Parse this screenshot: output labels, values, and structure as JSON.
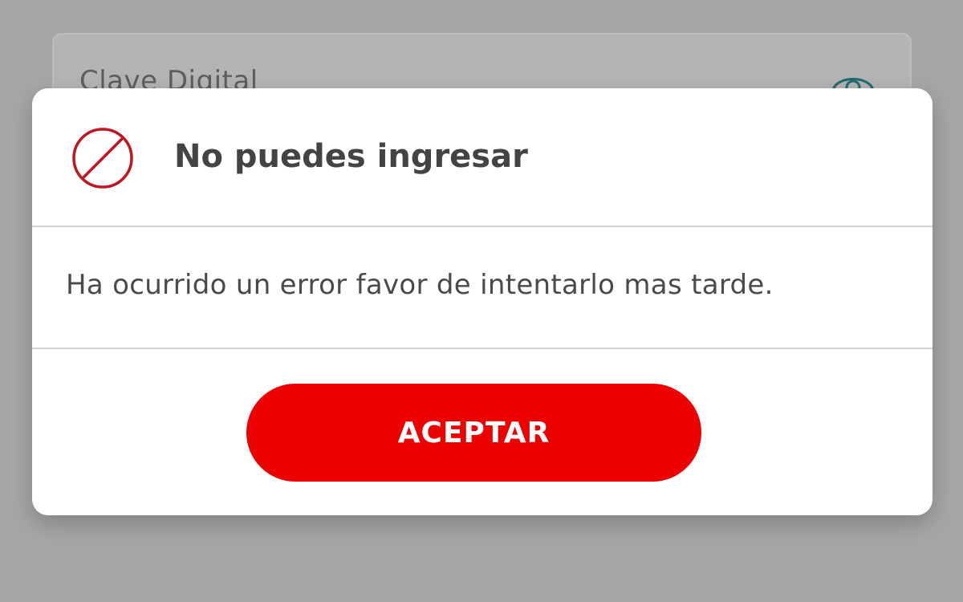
{
  "background": {
    "field_label": "Clave Digital",
    "icon": "eye-icon"
  },
  "dialog": {
    "icon": "block-icon",
    "title": "No puedes ingresar",
    "message": "Ha ocurrido un error favor de intentarlo mas tarde.",
    "accept_label": "ACEPTAR"
  },
  "colors": {
    "overlay_background": "#a6a6a8",
    "accent_red": "#ec0000",
    "icon_red": "#c0161e",
    "eye_teal": "#1f6c6c",
    "title_text": "#434343",
    "body_text": "#4a4a4a"
  }
}
